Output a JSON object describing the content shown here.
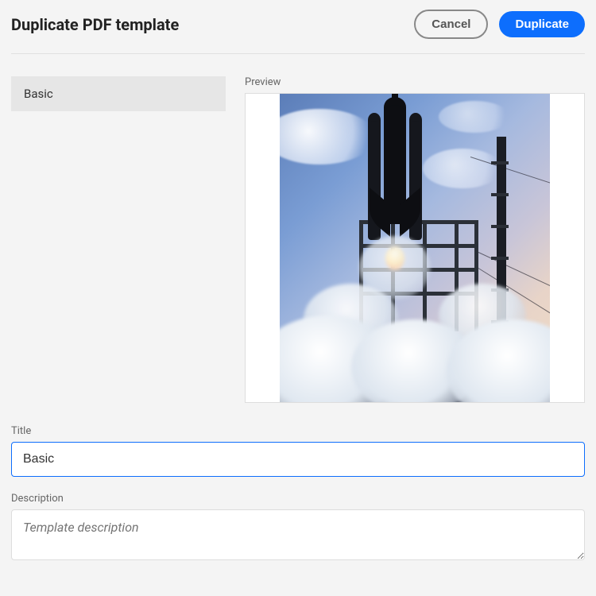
{
  "dialog": {
    "title": "Duplicate PDF template",
    "cancel_label": "Cancel",
    "primary_label": "Duplicate"
  },
  "sidebar": {
    "items": [
      {
        "label": "Basic"
      }
    ]
  },
  "preview": {
    "label": "Preview"
  },
  "form": {
    "title_label": "Title",
    "title_value": "Basic",
    "description_label": "Description",
    "description_placeholder": "Template description"
  }
}
